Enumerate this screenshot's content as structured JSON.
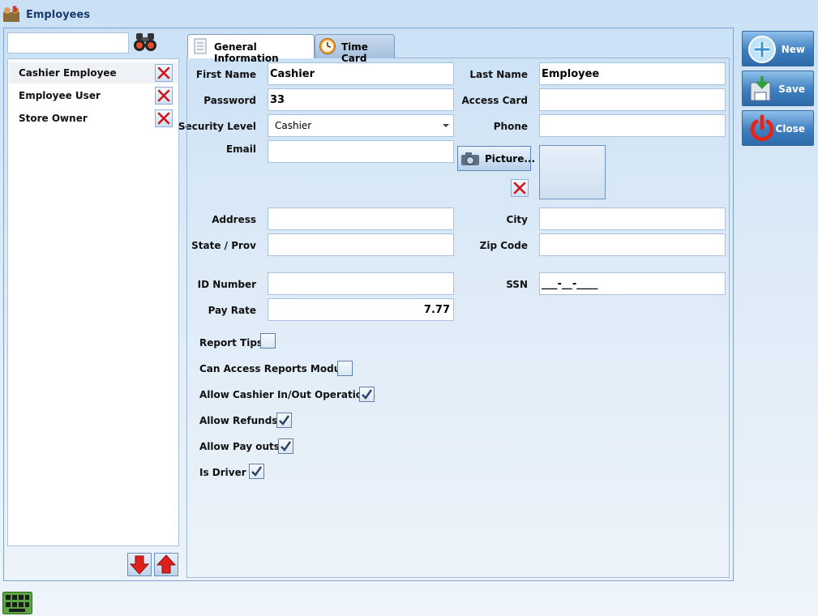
{
  "window": {
    "title": "Employees"
  },
  "search": {
    "value": "",
    "placeholder": ""
  },
  "employees": [
    {
      "name": "Cashier Employee",
      "selected": true
    },
    {
      "name": "Employee User",
      "selected": false
    },
    {
      "name": "Store Owner",
      "selected": false
    }
  ],
  "tabs": [
    {
      "label": "General Information",
      "active": true,
      "icon": "document-icon"
    },
    {
      "label": "Time Card",
      "active": false,
      "icon": "clock-icon"
    }
  ],
  "form": {
    "first_name": {
      "label": "First Name",
      "value": "Cashier"
    },
    "last_name": {
      "label": "Last Name",
      "value": "Employee"
    },
    "password": {
      "label": "Password",
      "value": "33"
    },
    "access_card": {
      "label": "Access Card",
      "value": ""
    },
    "security_level": {
      "label": "Security Level",
      "value": "Cashier"
    },
    "phone": {
      "label": "Phone",
      "value": ""
    },
    "email": {
      "label": "Email",
      "value": ""
    },
    "picture_button": "Picture...",
    "address": {
      "label": "Address",
      "value": ""
    },
    "city": {
      "label": "City",
      "value": ""
    },
    "state": {
      "label": "State / Prov",
      "value": ""
    },
    "zip": {
      "label": "Zip Code",
      "value": ""
    },
    "id_number": {
      "label": "ID Number",
      "value": ""
    },
    "ssn": {
      "label": "SSN",
      "value": "___-__-____"
    },
    "pay_rate": {
      "label": "Pay Rate",
      "value": "7.77"
    }
  },
  "checkboxes": [
    {
      "label": "Report Tips",
      "checked": false
    },
    {
      "label": "Can Access Reports Module",
      "checked": false
    },
    {
      "label": "Allow Cashier In/Out Operations",
      "checked": true
    },
    {
      "label": "Allow Refunds",
      "checked": true
    },
    {
      "label": "Allow Pay outs",
      "checked": true
    },
    {
      "label": "Is Driver",
      "checked": true
    }
  ],
  "actions": {
    "new": "New",
    "save": "Save",
    "close": "Close"
  },
  "colors": {
    "accent": "#3e7fc0",
    "title": "#1a3c6e",
    "delete_red": "#d0161c",
    "arrow_red": "#e0201c"
  }
}
